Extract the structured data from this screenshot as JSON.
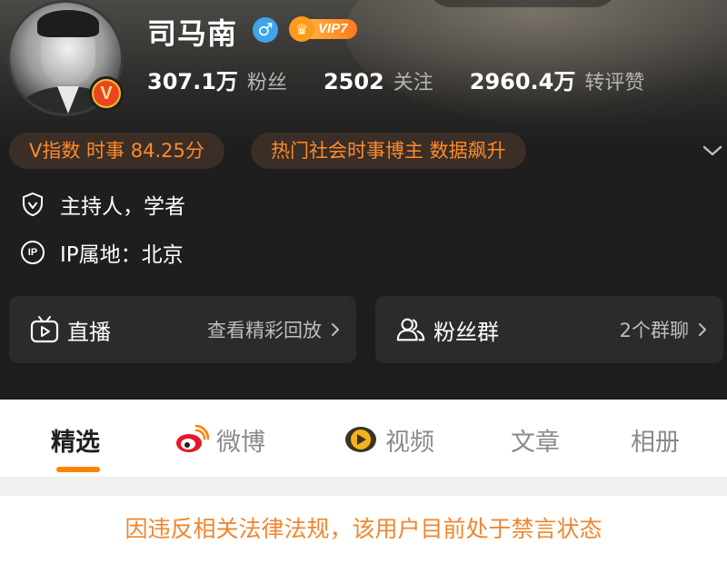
{
  "profile": {
    "name": "司马南",
    "gender_symbol": "♂",
    "vip_label": "VIP7",
    "verified_badge": "V",
    "stats": [
      {
        "value": "307.1万",
        "label": "粉丝"
      },
      {
        "value": "2502",
        "label": "关注"
      },
      {
        "value": "2960.4万",
        "label": "转评赞"
      }
    ],
    "chips": [
      "V指数 时事 84.25分",
      "热门社会时事博主 数据飙升"
    ],
    "verification_text": "主持人，学者",
    "ip_icon_text": "IP",
    "ip_location": "IP属地：北京"
  },
  "cards": {
    "live": {
      "title": "直播",
      "action": "查看精彩回放"
    },
    "fans": {
      "title": "粉丝群",
      "action": "2个群聊"
    }
  },
  "tabs": [
    {
      "label": "精选",
      "active": true
    },
    {
      "label": "微博",
      "active": false
    },
    {
      "label": "视频",
      "active": false
    },
    {
      "label": "文章",
      "active": false
    },
    {
      "label": "相册",
      "active": false
    }
  ],
  "notice": "因违反相关法律法规，该用户目前处于禁言状态",
  "colors": {
    "accent_orange": "#ff8200",
    "chip_text": "#ff8a2b",
    "notice_text": "#f1862f",
    "gender_blue": "#3fa4e8"
  }
}
